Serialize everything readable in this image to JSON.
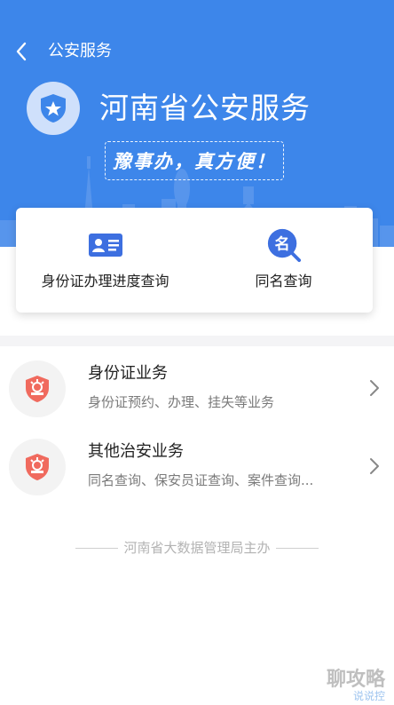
{
  "header": {
    "nav_title": "公安服务",
    "hero_title": "河南省公安服务",
    "slogan": "豫事办，真方便！"
  },
  "quick_actions": [
    {
      "label": "身份证办理进度查询",
      "icon": "id-card-icon"
    },
    {
      "label": "同名查询",
      "icon": "name-search-icon",
      "icon_text": "名"
    }
  ],
  "services": [
    {
      "title": "身份证业务",
      "description": "身份证预约、办理、挂失等业务",
      "icon": "police-badge-icon"
    },
    {
      "title": "其他治安业务",
      "description": "同名查询、保安员证查询、案件查询...",
      "icon": "police-badge-icon"
    }
  ],
  "footer": {
    "text": "河南省大数据管理局主办"
  },
  "watermark": {
    "text": "聊攻略",
    "subtext": "说说控"
  },
  "colors": {
    "primary": "#3d86ea",
    "badge": "#f06a5e",
    "id_card": "#3d6fe0"
  }
}
